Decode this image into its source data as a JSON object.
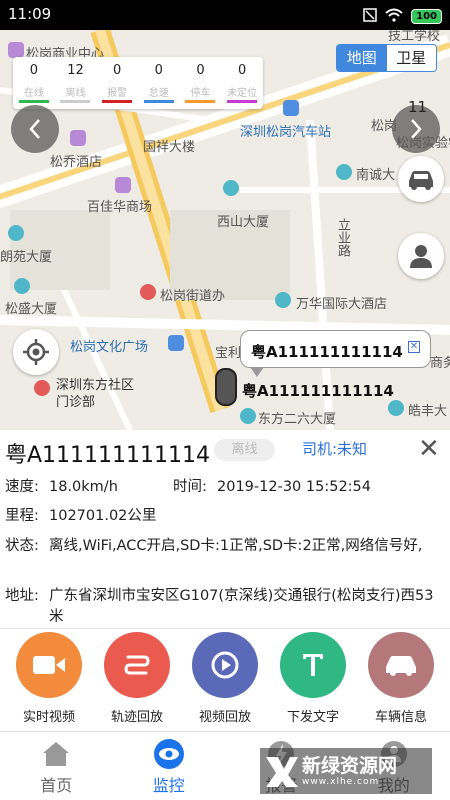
{
  "status_bar": {
    "time": "11:09",
    "battery": "100"
  },
  "map": {
    "stats": [
      {
        "count": "0",
        "label": "在线",
        "color": "#2fb84f"
      },
      {
        "count": "12",
        "label": "离线",
        "color": "#cccccc"
      },
      {
        "count": "0",
        "label": "报警",
        "color": "#d42020"
      },
      {
        "count": "0",
        "label": "怠速",
        "color": "#3f88de"
      },
      {
        "count": "0",
        "label": "停车",
        "color": "#f29a2e"
      },
      {
        "count": "0",
        "label": "未定位",
        "color": "#c53ad1"
      }
    ],
    "toggle": {
      "map": "地图",
      "satellite": "卫星"
    },
    "page_number": "11",
    "labels": [
      "松岗商业中心",
      "松乔酒店",
      "百佳华商场",
      "国祥大楼",
      "深圳松岗汽车站",
      "西山大厦",
      "南诚大",
      "立业路",
      "朗苑大厦",
      "松盛大厦",
      "松岗街道办",
      "万华国际大酒店",
      "松岗文化广场",
      "深圳东方社区门诊部",
      "宝利",
      "东方二六大厦",
      "皓丰大",
      "技工学校",
      "松岗实验学校",
      "松岗",
      "商务"
    ],
    "popup_plate": "粤A111111111114",
    "popup_close": "✕",
    "marker_plate": "粤A111111111114"
  },
  "detail": {
    "plate": "粤A111111111114",
    "status": "离线",
    "driver": "司机:未知",
    "close": "✕",
    "speed_key": "速度:",
    "speed_val": "18.0km/h",
    "time_key": "时间:",
    "time_val": "2019-12-30 15:52:54",
    "mileage_key": "里程:",
    "mileage_val": "102701.02公里",
    "state_key": "状态:",
    "state_val": "离线,WiFi,ACC开启,SD卡:1正常,SD卡:2正常,网络信号好,",
    "address_key": "地址:",
    "address_val": "广东省深圳市宝安区G107(京深线)交通银行(松岗支行)西53米"
  },
  "actions": [
    {
      "label": "实时视频",
      "icon": "video-camera-icon",
      "color": "#f28b3c"
    },
    {
      "label": "轨迹回放",
      "icon": "route-icon",
      "color": "#ea5a4e"
    },
    {
      "label": "视频回放",
      "icon": "replay-icon",
      "color": "#5a6ab8"
    },
    {
      "label": "下发文字",
      "icon": "text-icon",
      "color": "#2fb784"
    },
    {
      "label": "车辆信息",
      "icon": "car-icon",
      "color": "#b5787a"
    }
  ],
  "tabs": [
    {
      "label": "首页",
      "icon": "home-icon"
    },
    {
      "label": "监控",
      "icon": "eye-icon"
    },
    {
      "label": "报警",
      "icon": "alarm-icon"
    },
    {
      "label": "我的",
      "icon": "profile-icon"
    }
  ],
  "watermark": {
    "title": "新绿资源网",
    "url": "www.xlhe.com"
  }
}
